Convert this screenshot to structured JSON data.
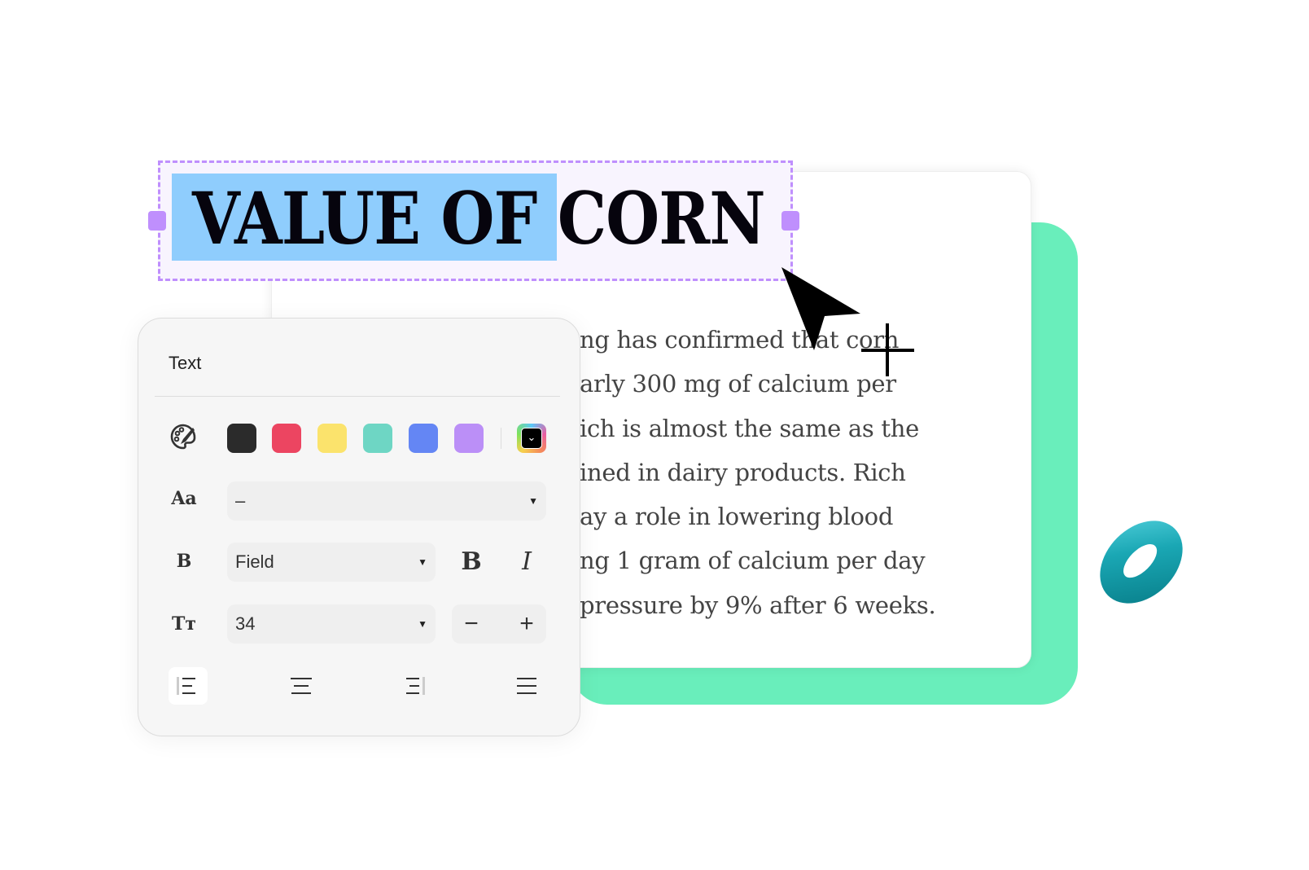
{
  "document": {
    "title_selected": "VALUE OF ",
    "title_rest": "CORN",
    "body_lines": [
      "ng has confirmed that corn",
      "arly 300 mg of calcium per",
      "ich is almost the same as the",
      "ined in dairy products. Rich",
      "ay a role in lowering blood",
      "ng 1 gram of calcium per day",
      "pressure by 9% after 6 weeks."
    ]
  },
  "panel": {
    "title": "Text",
    "colors": [
      "#2b2b2b",
      "#ec4561",
      "#fbe36c",
      "#6ed6c4",
      "#6486f4",
      "#bb8ff7"
    ],
    "palette_icon": "palette-icon",
    "custom_color_icon": "chevron-down-icon",
    "font_family": {
      "icon_label": "Aa",
      "value": "–"
    },
    "font_weight": {
      "icon_label": "B",
      "value": "Field",
      "bold_label": "B",
      "italic_label": "I"
    },
    "font_size": {
      "icon_label": "Tт",
      "value": "34",
      "decrease_label": "−",
      "increase_label": "+"
    },
    "alignment": {
      "selected": "left",
      "options": [
        "left",
        "center",
        "right",
        "justify"
      ]
    }
  },
  "colors": {
    "accent_green": "#69eebb",
    "selection": "#8fcdfd",
    "frame": "#bf8ffd"
  }
}
